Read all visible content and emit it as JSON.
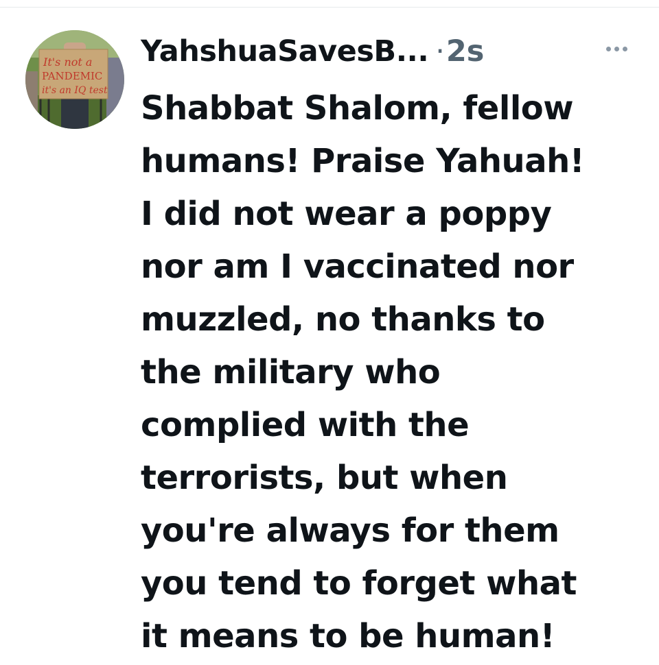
{
  "tweet": {
    "author": {
      "display_name": "YahshuaSavesB...",
      "avatar": {
        "description_icon": "profile-photo-protest-sign",
        "sign_lines": [
          "It's not a",
          "PANDEMIC",
          "it's an IQ test"
        ]
      }
    },
    "separator": "·",
    "timestamp": "2s",
    "more_icon": "ellipsis-icon",
    "text_lines": [
      "Shabbat Shalom, fellow",
      "humans! Praise Yahuah!",
      "I did not wear a poppy",
      "nor am I vaccinated nor",
      "muzzled, no thanks to",
      "the military who",
      "complied with the",
      "terrorists, but when",
      "you're always for them",
      "you tend to forget what",
      "it means to be human!"
    ]
  },
  "colors": {
    "text_primary": "#0f1419",
    "text_secondary": "#536471",
    "divider": "#e6e9ec",
    "background": "#ffffff"
  }
}
